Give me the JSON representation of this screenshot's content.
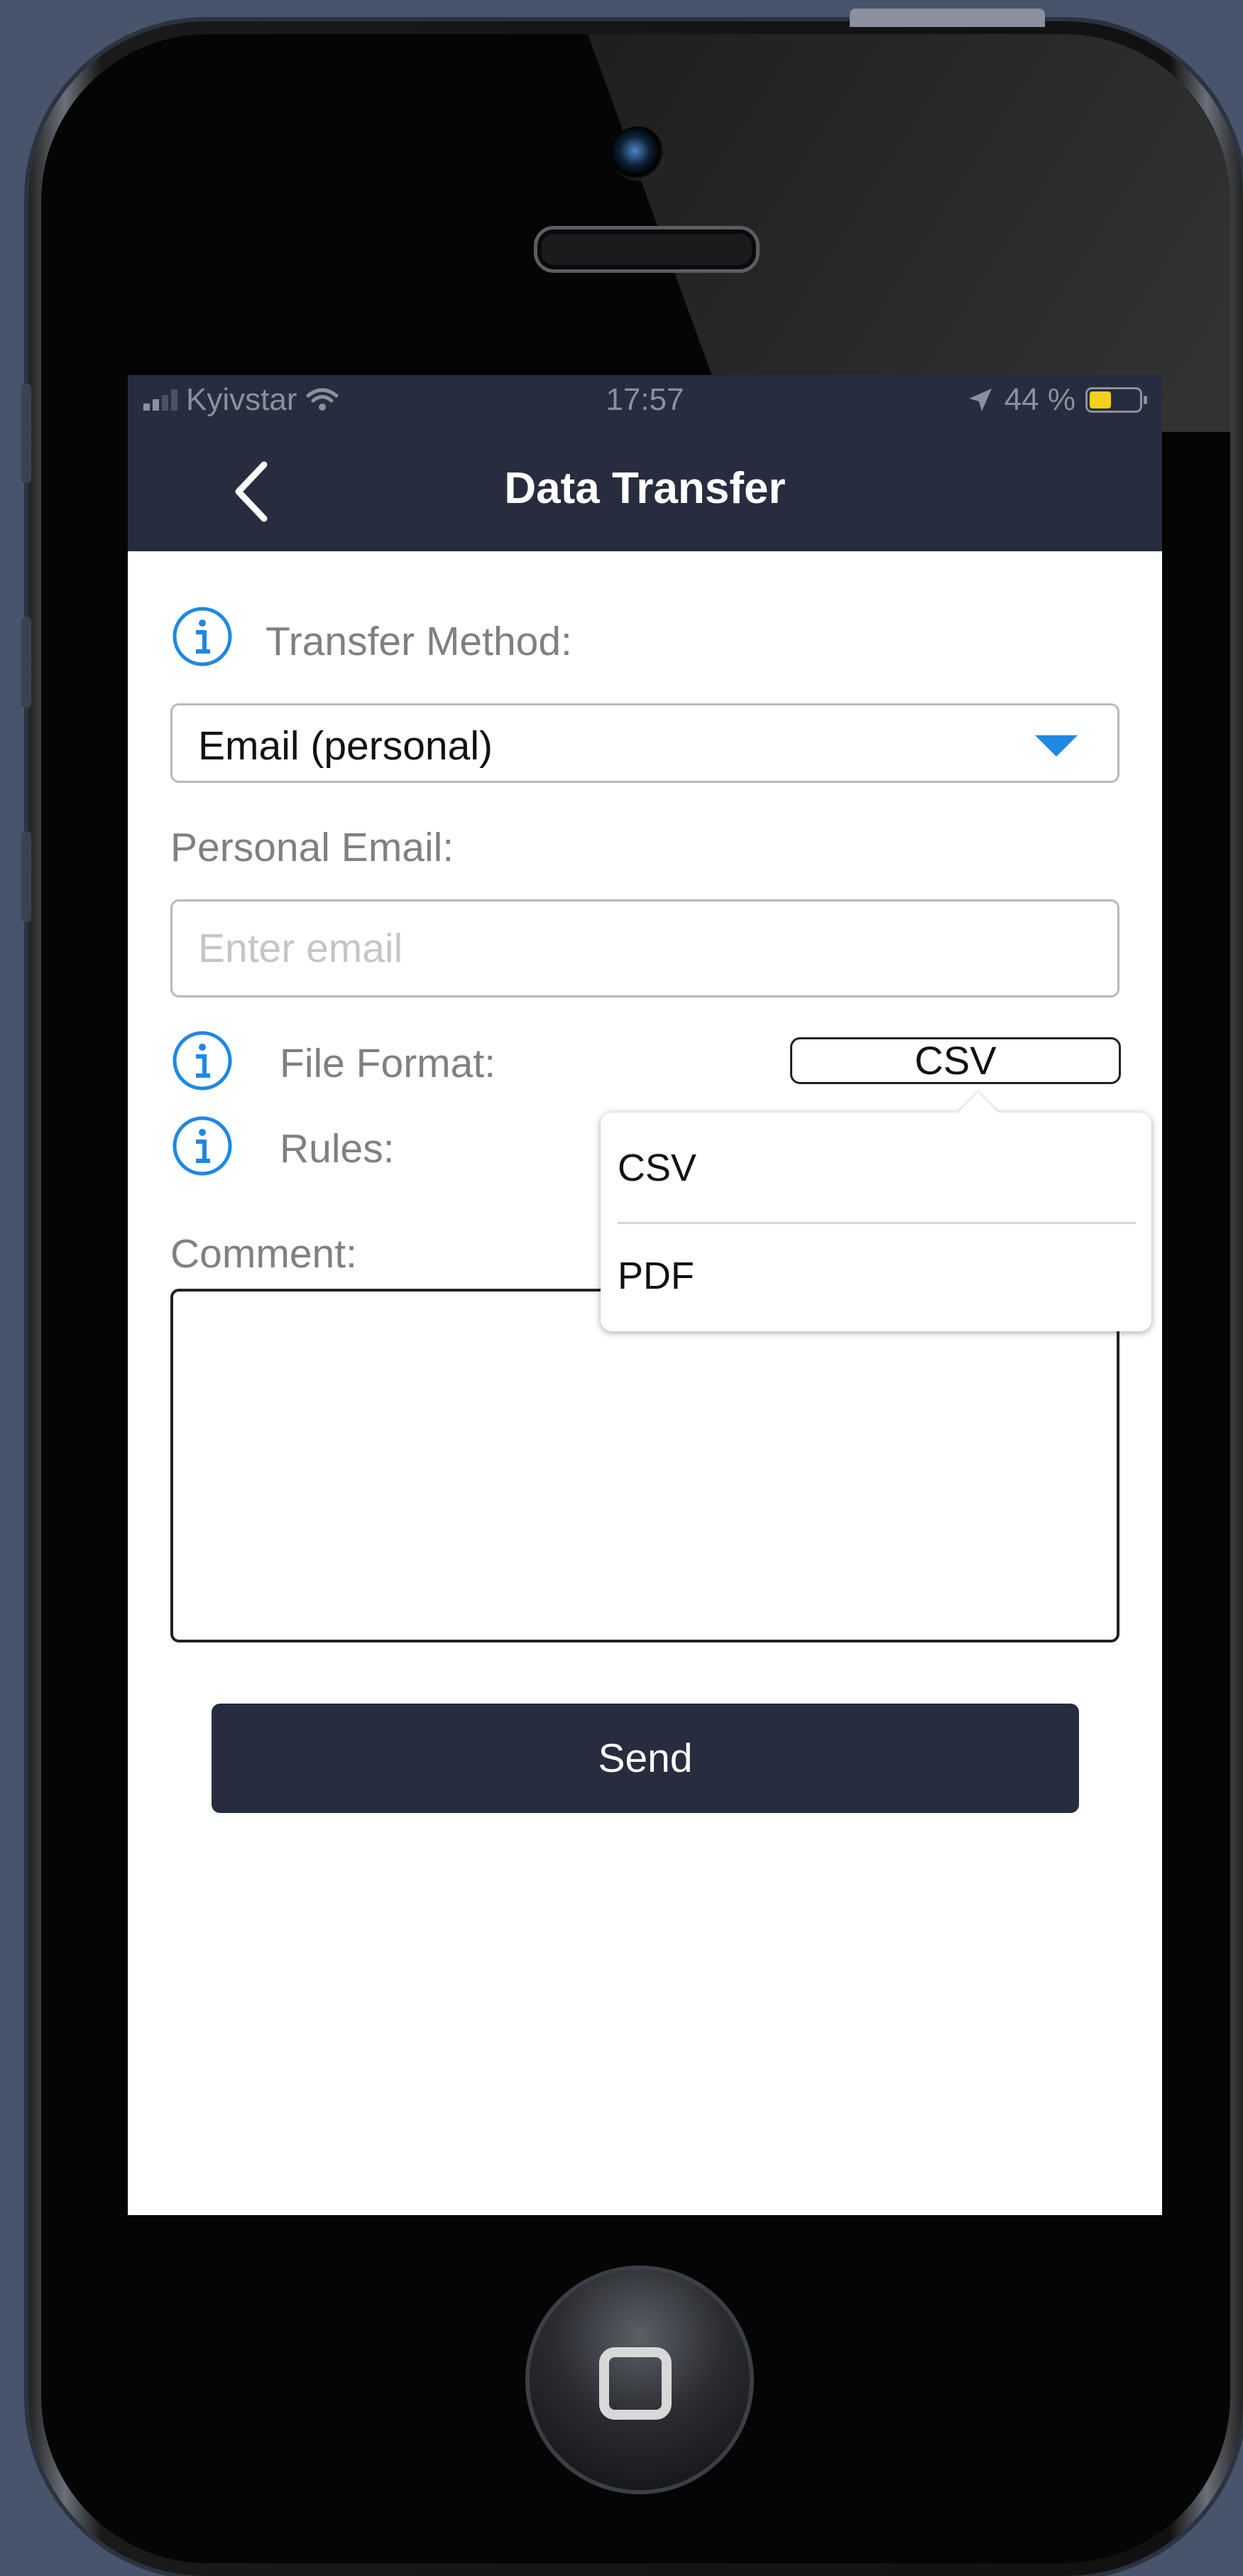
{
  "status_bar": {
    "carrier": "Kyivstar",
    "time": "17:57",
    "battery": "44 %",
    "battery_level": 0.44
  },
  "nav": {
    "title": "Data Transfer"
  },
  "form": {
    "transfer_method_label": "Transfer Method:",
    "transfer_method_value": "Email (personal)",
    "personal_email_label": "Personal Email:",
    "email_placeholder": "Enter email",
    "file_format_label": "File Format:",
    "file_format_value": "CSV",
    "rules_label": "Rules:",
    "comment_label": "Comment:",
    "send_label": "Send"
  },
  "format_popover": {
    "options": [
      "CSV",
      "PDF"
    ]
  },
  "colors": {
    "header_bg": "#272d3e",
    "accent_blue": "#1e88e5",
    "battery_yellow": "#f6d11b",
    "label_grey": "#808080"
  }
}
